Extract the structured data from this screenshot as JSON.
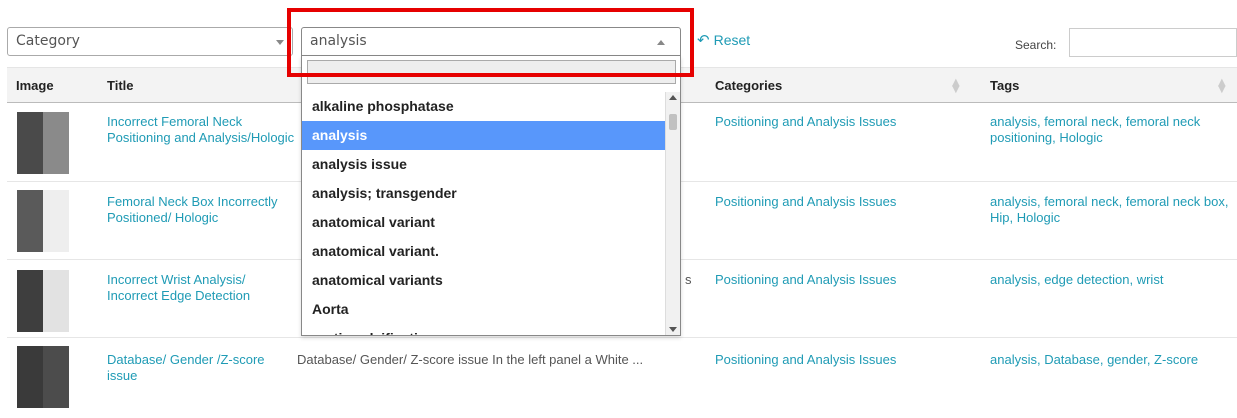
{
  "filters": {
    "category_placeholder": "Category",
    "tag_value": "analysis",
    "reset_label": "Reset",
    "search_label": "Search:",
    "search_value": ""
  },
  "table": {
    "headers": [
      "Image",
      "Title",
      "Categories",
      "Tags"
    ],
    "rows": [
      {
        "title": "Incorrect Femoral Neck Positioning and Analysis/Hologic",
        "description": "",
        "category": "Positioning and Analysis Issues",
        "tags": "analysis, femoral neck, femoral neck positioning, Hologic"
      },
      {
        "title": "Femoral Neck Box Incorrectly Positioned/ Hologic",
        "description": "",
        "category": "Positioning and Analysis Issues",
        "tags": "analysis, femoral neck, femoral neck box, Hip, Hologic"
      },
      {
        "title": "Incorrect Wrist Analysis/ Incorrect Edge Detection",
        "description": "s",
        "category": "Positioning and Analysis Issues",
        "tags": "analysis, edge detection, wrist"
      },
      {
        "title": "Database/ Gender /Z-score issue",
        "description": "Database/ Gender/ Z-score issue In the left panel a White ...",
        "category": "Positioning and Analysis Issues",
        "tags": "analysis, Database, gender, Z-score"
      }
    ]
  },
  "dropdown": {
    "search_value": "",
    "items": [
      "alkaline phosphatase",
      "analysis",
      "analysis issue",
      "analysis; transgender",
      "anatomical variant",
      "anatomical variant.",
      "anatomical variants",
      "Aorta",
      "aortic calcification"
    ],
    "selected_index": 1
  },
  "colors": {
    "link": "#1f9bb5",
    "selected_bg": "#5897fb",
    "highlight": "#e60000"
  }
}
